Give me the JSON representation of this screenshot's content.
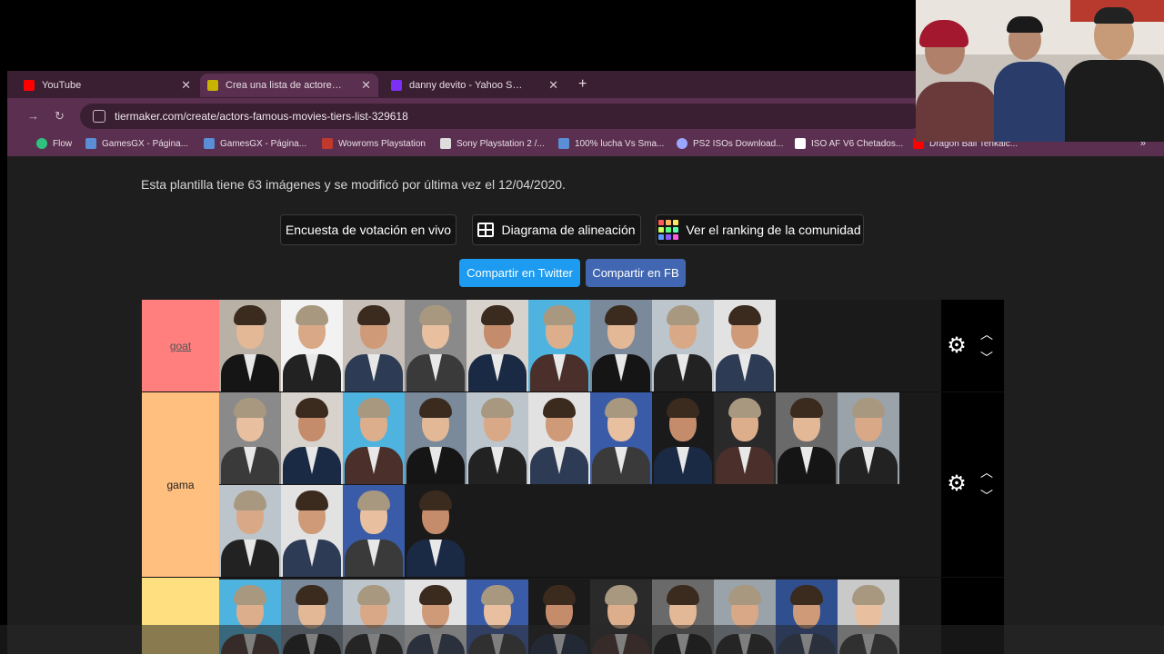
{
  "tabs": [
    {
      "label": "YouTube",
      "color": "#ff0000"
    },
    {
      "label": "Crea una lista de actores famos",
      "color": "#c8b400"
    },
    {
      "label": "danny devito - Yahoo Search Tu",
      "color": "#7b2ff7"
    }
  ],
  "address": {
    "url": "tiermaker.com/create/actors-famous-movies-tiers-list-329618"
  },
  "bookmarks": [
    {
      "label": "Flow",
      "color": "#2ec27e"
    },
    {
      "label": "GamesGX - Página...",
      "color": "#5a8fd8"
    },
    {
      "label": "GamesGX - Página...",
      "color": "#5a8fd8"
    },
    {
      "label": "Wowroms Playstation",
      "color": "#c0392b"
    },
    {
      "label": "Sony Playstation 2 /...",
      "color": "#dddddd"
    },
    {
      "label": "100% lucha Vs Sma...",
      "color": "#5a8fd8"
    },
    {
      "label": "PS2 ISOs Download...",
      "color": "#9aa7ff"
    },
    {
      "label": "ISO AF V6 Chetados...",
      "color": "#ffffff"
    },
    {
      "label": "Dragon Ball Tenkaic...",
      "color": "#ff0000"
    }
  ],
  "page": {
    "info_text": "Esta plantilla tiene 63 imágenes y se modificó por última vez el 12/04/2020.",
    "buttons": {
      "live_poll": "Encuesta de votación en vivo",
      "alignment": "Diagrama de alineación",
      "community": "Ver el ranking de la comunidad"
    },
    "share": {
      "twitter": "Compartir en Twitter",
      "facebook": "Compartir en FB"
    }
  },
  "colors": {
    "twitter": "#1d9bf0",
    "facebook": "#4267b2",
    "tier_goat": "#ff7f7f",
    "tier_gama": "#ffbf7f",
    "tier_third": "#ffdf7f"
  },
  "tiers": [
    {
      "label": "goat"
    },
    {
      "label": "gama"
    },
    {
      "label": ""
    }
  ],
  "icons": {
    "settings": "gear-icon",
    "up": "chevron-up-icon",
    "down": "chevron-down-icon"
  }
}
